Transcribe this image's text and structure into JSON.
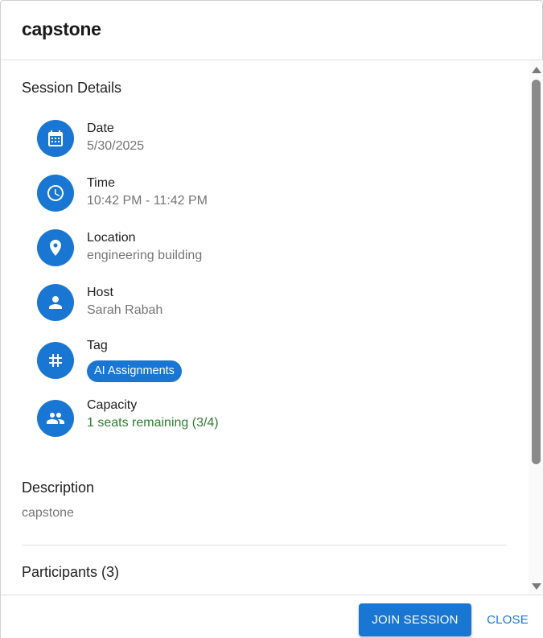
{
  "dialog": {
    "title": "capstone"
  },
  "session_details": {
    "heading": "Session Details",
    "date": {
      "label": "Date",
      "value": "5/30/2025",
      "icon": "calendar-icon"
    },
    "time": {
      "label": "Time",
      "value": "10:42 PM - 11:42 PM",
      "icon": "clock-icon"
    },
    "location": {
      "label": "Location",
      "value": "engineering building",
      "icon": "location-pin-icon"
    },
    "host": {
      "label": "Host",
      "value": "Sarah Rabah",
      "icon": "person-icon"
    },
    "tag": {
      "label": "Tag",
      "value": "AI Assignments",
      "icon": "hashtag-icon"
    },
    "capacity": {
      "label": "Capacity",
      "value": "1 seats remaining (3/4)",
      "icon": "people-icon",
      "value_color": "#2e7d32"
    }
  },
  "description": {
    "heading": "Description",
    "text": "capstone"
  },
  "participants": {
    "heading": "Participants (3)"
  },
  "actions": {
    "join_label": "JOIN SESSION",
    "close_label": "CLOSE"
  },
  "colors": {
    "accent": "#1976d2",
    "success": "#2e7d32",
    "muted_text": "#757575"
  }
}
